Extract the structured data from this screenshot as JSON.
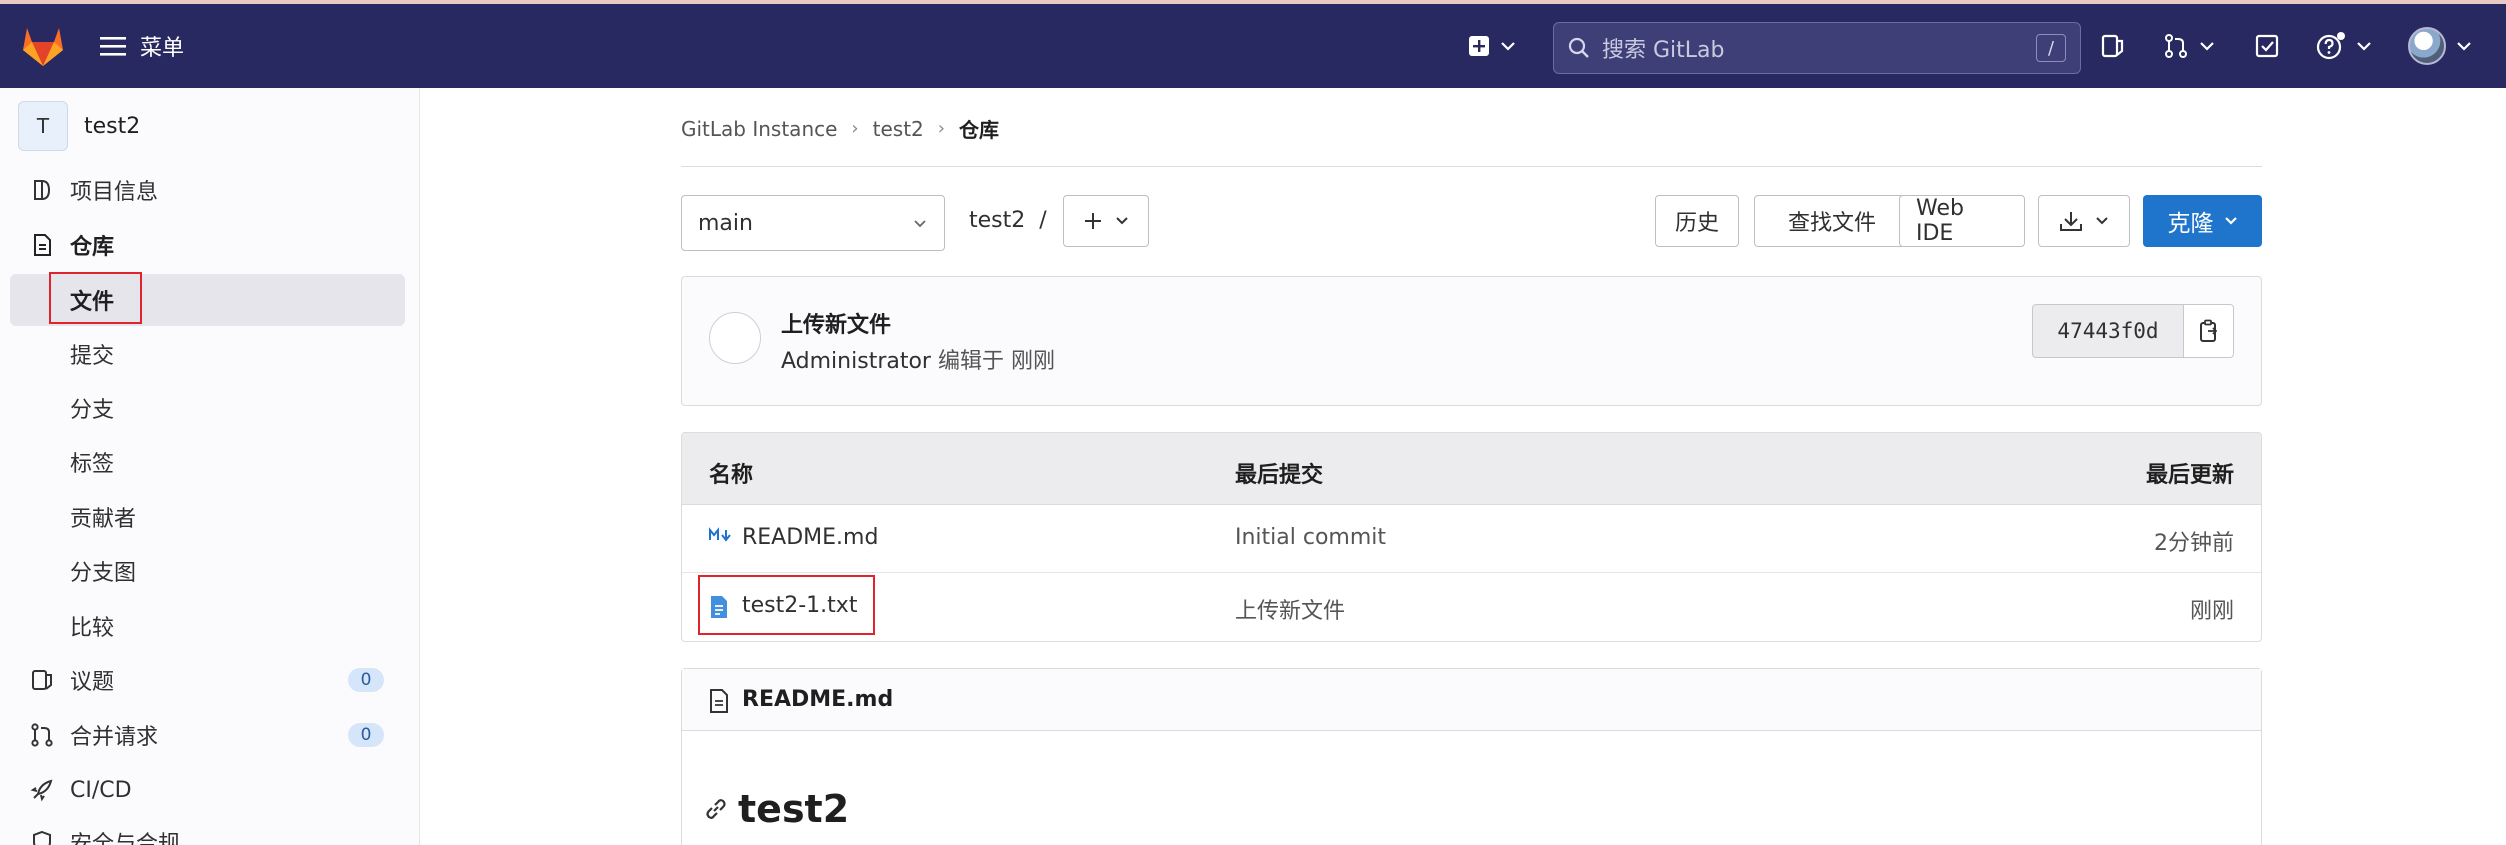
{
  "topbar": {
    "menu_label": "菜单",
    "search_placeholder": "搜索 GitLab",
    "search_shortcut": "/"
  },
  "sidebar": {
    "project_avatar_letter": "T",
    "project_name": "test2",
    "items": [
      {
        "label": "项目信息",
        "icon": "project-info-icon"
      },
      {
        "label": "仓库",
        "icon": "repository-icon"
      },
      {
        "label": "文件"
      },
      {
        "label": "提交"
      },
      {
        "label": "分支"
      },
      {
        "label": "标签"
      },
      {
        "label": "贡献者"
      },
      {
        "label": "分支图"
      },
      {
        "label": "比较"
      },
      {
        "label": "议题",
        "icon": "issues-icon",
        "badge": "0"
      },
      {
        "label": "合并请求",
        "icon": "merge-request-icon",
        "badge": "0"
      },
      {
        "label": "CI/CD",
        "icon": "rocket-icon"
      },
      {
        "label": "安全与合规",
        "icon": "shield-icon"
      }
    ]
  },
  "breadcrumb": [
    "GitLab Instance",
    "test2",
    "仓库"
  ],
  "toolbar": {
    "branch": "main",
    "path": "test2",
    "path_sep": "/",
    "history": "历史",
    "find_file": "查找文件",
    "web_ide": "Web IDE",
    "clone": "克隆"
  },
  "last_commit": {
    "title": "上传新文件",
    "author": "Administrator",
    "action": "编辑于",
    "time": "刚刚",
    "sha": "47443f0d"
  },
  "file_table": {
    "headers": [
      "名称",
      "最后提交",
      "最后更新"
    ],
    "rows": [
      {
        "name": "README.md",
        "icon": "markdown-icon",
        "commit": "Initial commit",
        "updated": "2分钟前"
      },
      {
        "name": "test2-1.txt",
        "icon": "text-file-icon",
        "commit": "上传新文件",
        "updated": "刚刚"
      }
    ]
  },
  "readme": {
    "filename": "README.md",
    "heading": "test2"
  },
  "colors": {
    "nav_bg": "#292961",
    "primary": "#1f75cb",
    "highlight_box": "#e0242e"
  }
}
